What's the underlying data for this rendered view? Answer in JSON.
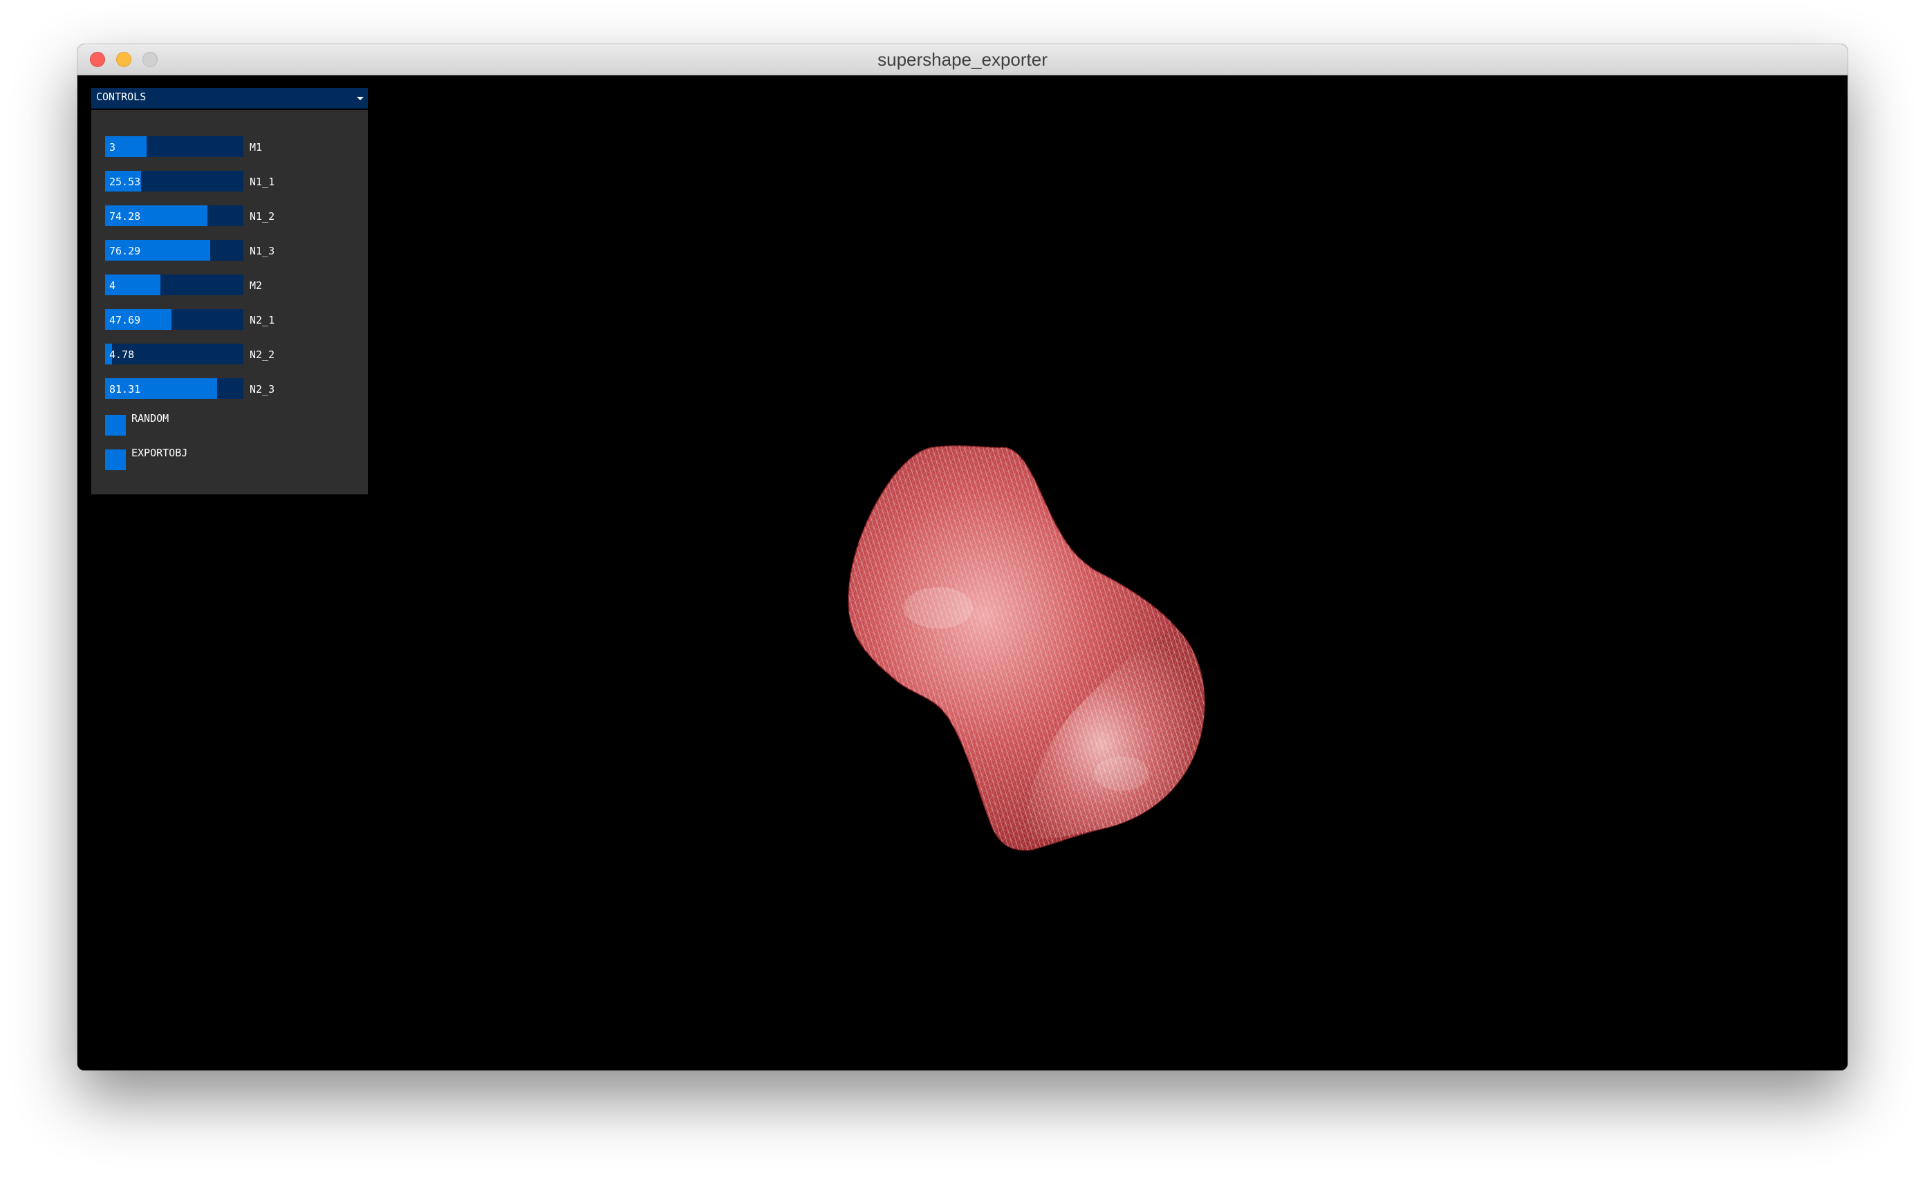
{
  "window": {
    "title": "supershape_exporter"
  },
  "controls": {
    "header": "CONTROLS",
    "sliders": [
      {
        "name": "M1",
        "value": "3",
        "fill": 0.3
      },
      {
        "name": "N1_1",
        "value": "25.53",
        "fill": 0.26
      },
      {
        "name": "N1_2",
        "value": "74.28",
        "fill": 0.74
      },
      {
        "name": "N1_3",
        "value": "76.29",
        "fill": 0.76
      },
      {
        "name": "M2",
        "value": "4",
        "fill": 0.4
      },
      {
        "name": "N2_1",
        "value": "47.69",
        "fill": 0.48
      },
      {
        "name": "N2_2",
        "value": "4.78",
        "fill": 0.05
      },
      {
        "name": "N2_3",
        "value": "81.31",
        "fill": 0.81
      }
    ],
    "toggles": [
      {
        "name": "RANDOM"
      },
      {
        "name": "EXPORTOBJ"
      }
    ]
  },
  "colors": {
    "accent": "#0073de",
    "slider_bg": "#002b5c",
    "panel_bg": "#2f2f2f",
    "shape": "#c8454a"
  }
}
